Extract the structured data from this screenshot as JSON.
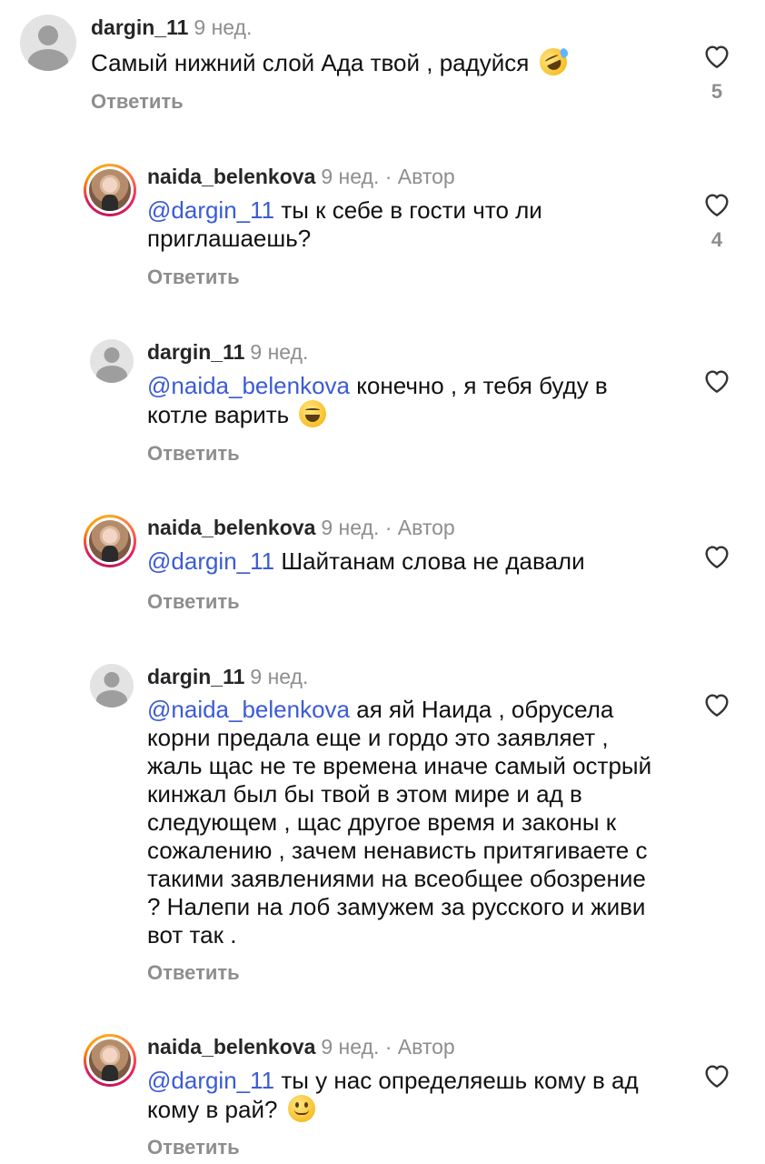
{
  "comments": [
    {
      "username": "dargin_11",
      "time": "9 нед.",
      "mention": "",
      "text": "Самый нижний слой Ада твой , радуйся",
      "emoji": "rolling-on-floor-laughing",
      "reply": "Ответить",
      "likes": "5",
      "avatar": "default-avatar"
    },
    {
      "username": "naida_belenkova",
      "time": "9 нед. · Автор",
      "mention": "@dargin_11",
      "text": " ты к себе в гости что ли приглашаешь?",
      "emoji": "",
      "reply": "Ответить",
      "likes": "4",
      "avatar": "profile-photo"
    },
    {
      "username": "dargin_11",
      "time": "9 нед.",
      "mention": "@naida_belenkova",
      "text": " конечно , я тебя буду в котле варить",
      "emoji": "grinning-face",
      "reply": "Ответить",
      "likes": "",
      "avatar": "default-avatar"
    },
    {
      "username": "naida_belenkova",
      "time": "9 нед. · Автор",
      "mention": "@dargin_11",
      "text": " Шайтанам слова не давали",
      "emoji": "",
      "reply": "Ответить",
      "likes": "",
      "avatar": "profile-photo"
    },
    {
      "username": "dargin_11",
      "time": "9 нед.",
      "mention": "@naida_belenkova",
      "text": " ая яй Наида , обрусела корни предала еще и гордо это заявляет , жаль щас не те времена иначе самый острый кинжал был бы твой в этом мире и ад в следующем , щас другое время и законы к сожалению , зачем ненависть притягиваете с такими заявлениями на всеобщее обозрение ? Налепи на лоб замужем за русского и живи вот так .",
      "emoji": "",
      "reply": "Ответить",
      "likes": "",
      "avatar": "default-avatar"
    },
    {
      "username": "naida_belenkova",
      "time": "9 нед. · Автор",
      "mention": "@dargin_11",
      "text": " ты у нас определяешь кому в ад кому в рай?",
      "emoji": "slightly-smiling-face",
      "reply": "Ответить",
      "likes": "",
      "avatar": "profile-photo"
    }
  ],
  "colors": {
    "mention": "#3b5bd6",
    "muted": "#8e8e8e",
    "text": "#111111"
  },
  "icons": {
    "like": "heart-outline-icon"
  }
}
